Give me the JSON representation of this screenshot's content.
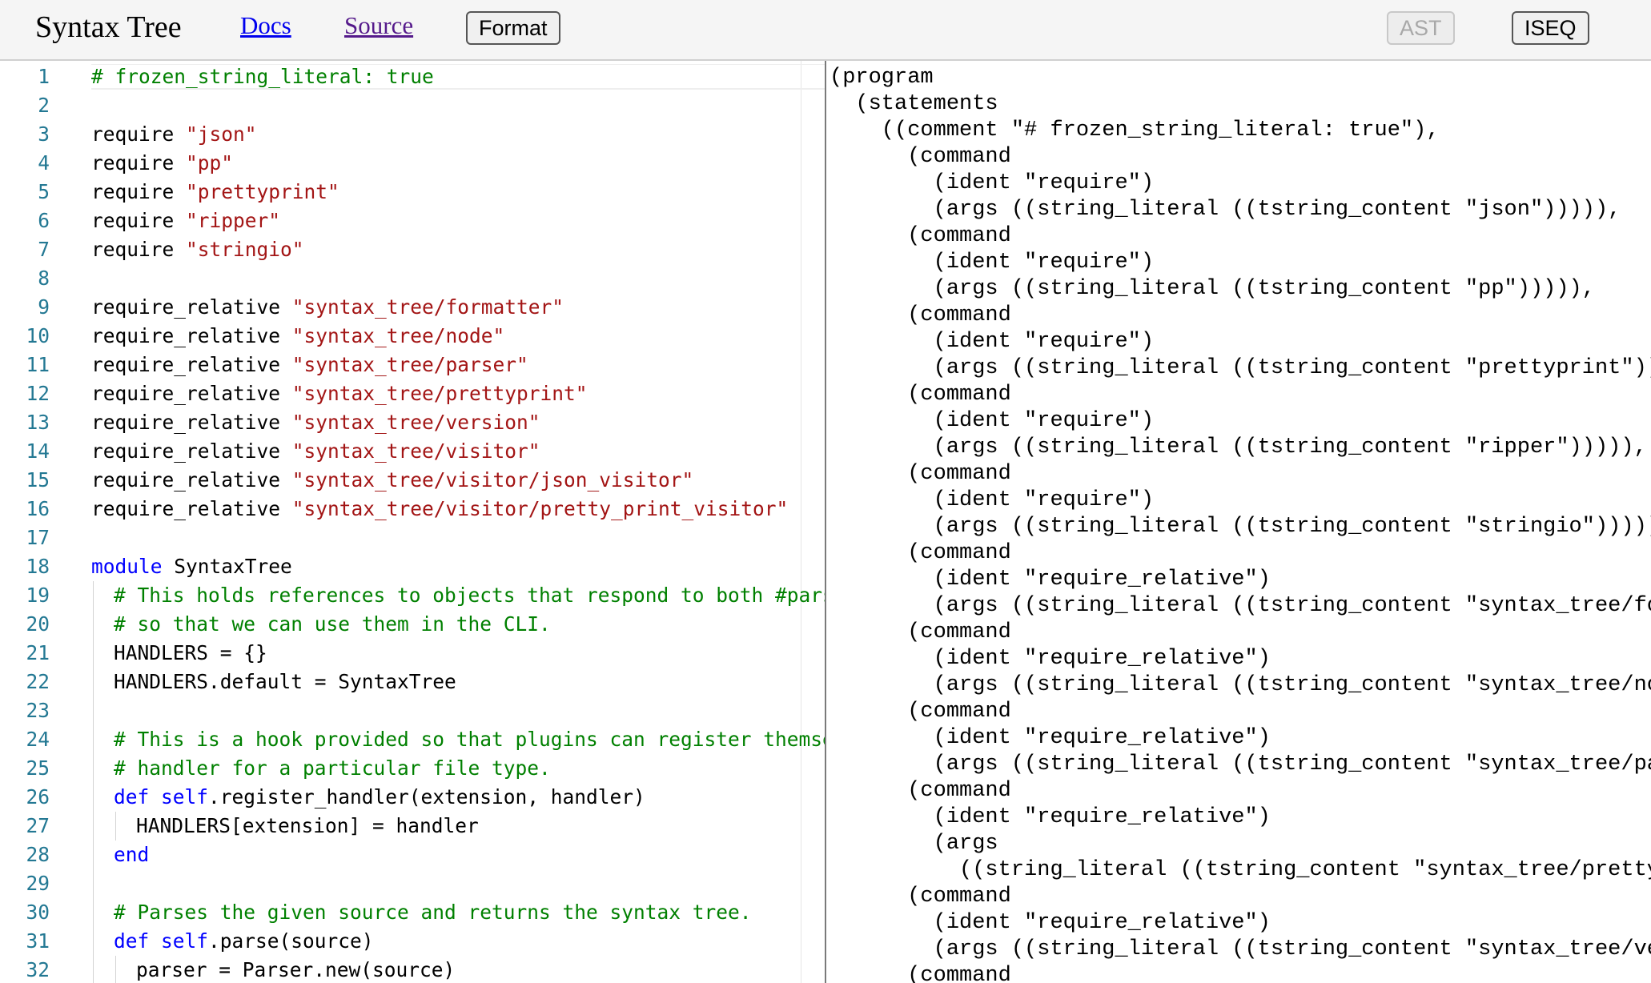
{
  "header": {
    "title": "Syntax Tree",
    "nav": {
      "docs": "Docs",
      "source": "Source"
    },
    "buttons": {
      "format": "Format",
      "ast": "AST",
      "iseq": "ISEQ"
    }
  },
  "editor": {
    "lines": [
      {
        "n": "1",
        "indent": 0,
        "tokens": [
          [
            "comment",
            "# frozen_string_literal: true"
          ]
        ]
      },
      {
        "n": "2",
        "indent": 0,
        "tokens": []
      },
      {
        "n": "3",
        "indent": 0,
        "tokens": [
          [
            "plain",
            "require "
          ],
          [
            "string",
            "\"json\""
          ]
        ]
      },
      {
        "n": "4",
        "indent": 0,
        "tokens": [
          [
            "plain",
            "require "
          ],
          [
            "string",
            "\"pp\""
          ]
        ]
      },
      {
        "n": "5",
        "indent": 0,
        "tokens": [
          [
            "plain",
            "require "
          ],
          [
            "string",
            "\"prettyprint\""
          ]
        ]
      },
      {
        "n": "6",
        "indent": 0,
        "tokens": [
          [
            "plain",
            "require "
          ],
          [
            "string",
            "\"ripper\""
          ]
        ]
      },
      {
        "n": "7",
        "indent": 0,
        "tokens": [
          [
            "plain",
            "require "
          ],
          [
            "string",
            "\"stringio\""
          ]
        ]
      },
      {
        "n": "8",
        "indent": 0,
        "tokens": []
      },
      {
        "n": "9",
        "indent": 0,
        "tokens": [
          [
            "plain",
            "require_relative "
          ],
          [
            "string",
            "\"syntax_tree/formatter\""
          ]
        ]
      },
      {
        "n": "10",
        "indent": 0,
        "tokens": [
          [
            "plain",
            "require_relative "
          ],
          [
            "string",
            "\"syntax_tree/node\""
          ]
        ]
      },
      {
        "n": "11",
        "indent": 0,
        "tokens": [
          [
            "plain",
            "require_relative "
          ],
          [
            "string",
            "\"syntax_tree/parser\""
          ]
        ]
      },
      {
        "n": "12",
        "indent": 0,
        "tokens": [
          [
            "plain",
            "require_relative "
          ],
          [
            "string",
            "\"syntax_tree/prettyprint\""
          ]
        ]
      },
      {
        "n": "13",
        "indent": 0,
        "tokens": [
          [
            "plain",
            "require_relative "
          ],
          [
            "string",
            "\"syntax_tree/version\""
          ]
        ]
      },
      {
        "n": "14",
        "indent": 0,
        "tokens": [
          [
            "plain",
            "require_relative "
          ],
          [
            "string",
            "\"syntax_tree/visitor\""
          ]
        ]
      },
      {
        "n": "15",
        "indent": 0,
        "tokens": [
          [
            "plain",
            "require_relative "
          ],
          [
            "string",
            "\"syntax_tree/visitor/json_visitor\""
          ]
        ]
      },
      {
        "n": "16",
        "indent": 0,
        "tokens": [
          [
            "plain",
            "require_relative "
          ],
          [
            "string",
            "\"syntax_tree/visitor/pretty_print_visitor\""
          ]
        ]
      },
      {
        "n": "17",
        "indent": 0,
        "tokens": []
      },
      {
        "n": "18",
        "indent": 0,
        "tokens": [
          [
            "keyword",
            "module"
          ],
          [
            "plain",
            " SyntaxTree"
          ]
        ]
      },
      {
        "n": "19",
        "indent": 1,
        "tokens": [
          [
            "comment",
            "# This holds references to objects that respond to both #parse"
          ]
        ]
      },
      {
        "n": "20",
        "indent": 1,
        "tokens": [
          [
            "comment",
            "# so that we can use them in the CLI."
          ]
        ]
      },
      {
        "n": "21",
        "indent": 1,
        "tokens": [
          [
            "plain",
            "HANDLERS = {}"
          ]
        ]
      },
      {
        "n": "22",
        "indent": 1,
        "tokens": [
          [
            "plain",
            "HANDLERS.default = SyntaxTree"
          ]
        ]
      },
      {
        "n": "23",
        "indent": 1,
        "tokens": []
      },
      {
        "n": "24",
        "indent": 1,
        "tokens": [
          [
            "comment",
            "# This is a hook provided so that plugins can register themselves"
          ]
        ]
      },
      {
        "n": "25",
        "indent": 1,
        "tokens": [
          [
            "comment",
            "# handler for a particular file type."
          ]
        ]
      },
      {
        "n": "26",
        "indent": 1,
        "tokens": [
          [
            "keyword",
            "def"
          ],
          [
            "plain",
            " "
          ],
          [
            "keyword",
            "self"
          ],
          [
            "plain",
            ".register_handler(extension, handler)"
          ]
        ]
      },
      {
        "n": "27",
        "indent": 2,
        "tokens": [
          [
            "plain",
            "HANDLERS[extension] = handler"
          ]
        ]
      },
      {
        "n": "28",
        "indent": 1,
        "tokens": [
          [
            "keyword",
            "end"
          ]
        ]
      },
      {
        "n": "29",
        "indent": 1,
        "tokens": []
      },
      {
        "n": "30",
        "indent": 1,
        "tokens": [
          [
            "comment",
            "# Parses the given source and returns the syntax tree."
          ]
        ]
      },
      {
        "n": "31",
        "indent": 1,
        "tokens": [
          [
            "keyword",
            "def"
          ],
          [
            "plain",
            " "
          ],
          [
            "keyword",
            "self"
          ],
          [
            "plain",
            ".parse(source)"
          ]
        ]
      },
      {
        "n": "32",
        "indent": 2,
        "tokens": [
          [
            "plain",
            "parser = Parser.new(source)"
          ]
        ]
      }
    ]
  },
  "output": {
    "lines": [
      "(program",
      "  (statements",
      "    ((comment \"# frozen_string_literal: true\"),",
      "      (command",
      "        (ident \"require\")",
      "        (args ((string_literal ((tstring_content \"json\"))))),",
      "      (command",
      "        (ident \"require\")",
      "        (args ((string_literal ((tstring_content \"pp\"))))),",
      "      (command",
      "        (ident \"require\")",
      "        (args ((string_literal ((tstring_content \"prettyprint\"))))),",
      "      (command",
      "        (ident \"require\")",
      "        (args ((string_literal ((tstring_content \"ripper\"))))),",
      "      (command",
      "        (ident \"require\")",
      "        (args ((string_literal ((tstring_content \"stringio\"))))),",
      "      (command",
      "        (ident \"require_relative\")",
      "        (args ((string_literal ((tstring_content \"syntax_tree/formatter\"))))),",
      "      (command",
      "        (ident \"require_relative\")",
      "        (args ((string_literal ((tstring_content \"syntax_tree/node\"))))),",
      "      (command",
      "        (ident \"require_relative\")",
      "        (args ((string_literal ((tstring_content \"syntax_tree/parser\"))))),",
      "      (command",
      "        (ident \"require_relative\")",
      "        (args",
      "          ((string_literal ((tstring_content \"syntax_tree/prettyprint\"))))),",
      "      (command",
      "        (ident \"require_relative\")",
      "        (args ((string_literal ((tstring_content \"syntax_tree/version\"))))),",
      "      (command"
    ]
  },
  "colors": {
    "comment": "#008000",
    "keyword": "#0000ff",
    "string": "#a31515",
    "line_number": "#237893",
    "link": "#0000ee",
    "visited_link": "#551a8b"
  }
}
